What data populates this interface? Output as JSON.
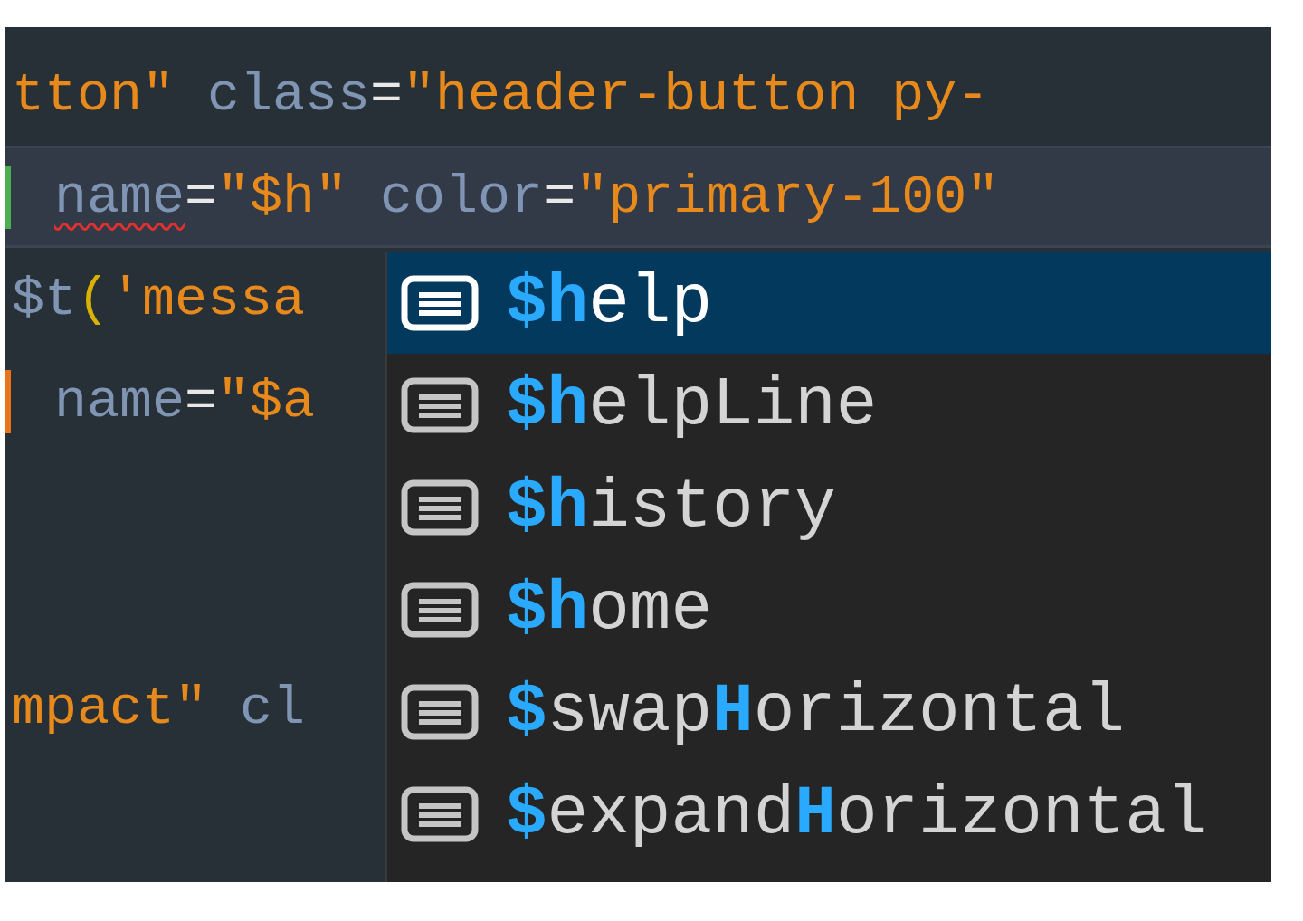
{
  "editor": {
    "lines": [
      {
        "highlighted": false,
        "segments": [
          {
            "kind": "string",
            "text": "tton\""
          },
          {
            "kind": "attr",
            "text": " class"
          },
          {
            "kind": "punct",
            "text": "="
          },
          {
            "kind": "string",
            "text": "\"header-button py-"
          }
        ]
      },
      {
        "highlighted": true,
        "color": "#4caf50",
        "segments": [
          {
            "kind": "attr",
            "text": "name",
            "error": true
          },
          {
            "kind": "punct",
            "text": "="
          },
          {
            "kind": "string",
            "text": "\"$h\""
          },
          {
            "kind": "attr",
            "text": " color"
          },
          {
            "kind": "punct",
            "text": "="
          },
          {
            "kind": "string",
            "text": "\"primary-100\""
          }
        ]
      },
      {
        "highlighted": false,
        "segments": [
          {
            "kind": "attr",
            "text": "$t"
          },
          {
            "kind": "bracket",
            "text": "("
          },
          {
            "kind": "string",
            "text": "'messa"
          }
        ]
      },
      {
        "highlighted": false,
        "color": "#e8751a",
        "segments": [
          {
            "kind": "attr",
            "text": "name"
          },
          {
            "kind": "punct",
            "text": "="
          },
          {
            "kind": "string",
            "text": "\"$a"
          }
        ]
      },
      {
        "highlighted": false
      },
      {
        "highlighted": false
      },
      {
        "highlighted": false,
        "segments": [
          {
            "kind": "string",
            "text": "mpact\""
          },
          {
            "kind": "attr",
            "text": " cl"
          }
        ]
      }
    ]
  },
  "suggestions": [
    {
      "selected": true,
      "parts": [
        {
          "text": "$h",
          "match": true
        },
        {
          "text": "elp",
          "match": false
        }
      ]
    },
    {
      "selected": false,
      "parts": [
        {
          "text": "$h",
          "match": true
        },
        {
          "text": "elpLine",
          "match": false
        }
      ]
    },
    {
      "selected": false,
      "parts": [
        {
          "text": "$h",
          "match": true
        },
        {
          "text": "istory",
          "match": false
        }
      ]
    },
    {
      "selected": false,
      "parts": [
        {
          "text": "$h",
          "match": true
        },
        {
          "text": "ome",
          "match": false
        }
      ]
    },
    {
      "selected": false,
      "parts": [
        {
          "text": "$",
          "match": true
        },
        {
          "text": "swap",
          "match": false
        },
        {
          "text": "H",
          "match": true
        },
        {
          "text": "orizontal",
          "match": false
        }
      ]
    },
    {
      "selected": false,
      "parts": [
        {
          "text": "$",
          "match": true
        },
        {
          "text": "expand",
          "match": false
        },
        {
          "text": "H",
          "match": true
        },
        {
          "text": "orizontal",
          "match": false
        }
      ]
    }
  ]
}
